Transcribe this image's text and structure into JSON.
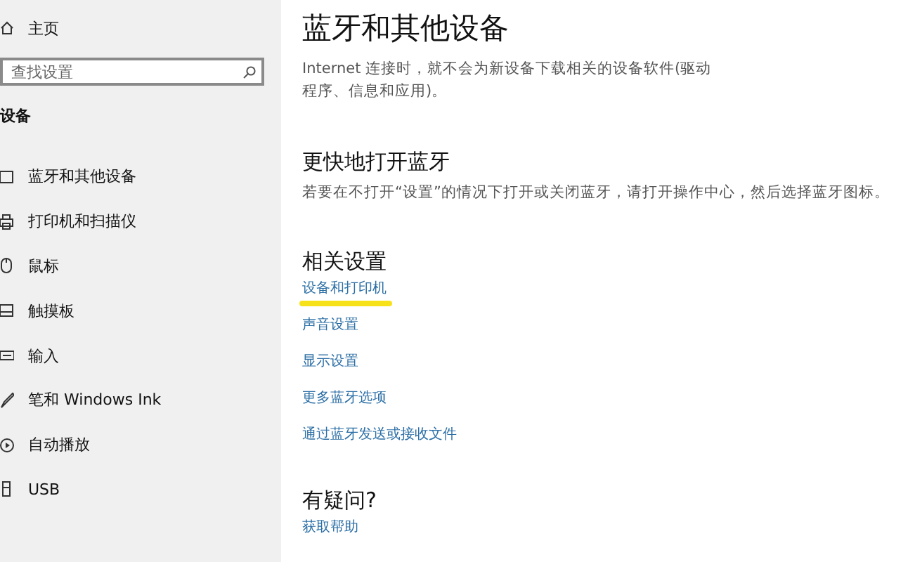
{
  "sidebar": {
    "home": "主页",
    "search": {
      "placeholder": "查找设置"
    },
    "section": "设备",
    "items": [
      {
        "label": "蓝牙和其他设备",
        "kind": "bluetooth",
        "selected": false
      },
      {
        "label": "打印机和扫描仪",
        "kind": "printer",
        "selected": false
      },
      {
        "label": "鼠标",
        "kind": "mouse",
        "selected": false
      },
      {
        "label": "触摸板",
        "kind": "touchpad",
        "selected": false
      },
      {
        "label": "输入",
        "kind": "keyboard",
        "selected": false
      },
      {
        "label": "笔和 Windows Ink",
        "kind": "pen",
        "selected": false
      },
      {
        "label": "自动播放",
        "kind": "autoplay",
        "selected": false
      },
      {
        "label": "USB",
        "kind": "usb",
        "selected": false
      }
    ]
  },
  "content": {
    "title": "蓝牙和其他设备",
    "intro": "Internet 连接时，就不会为新设备下载相关的设备软件(驱动程序、信息和应用)。",
    "sections": [
      {
        "heading": "更快地打开蓝牙",
        "text": "若要在不打开“设置”的情况下打开或关闭蓝牙，请打开操作中心，然后选择蓝牙图标。"
      },
      {
        "heading": "相关设置",
        "links": [
          {
            "label": "设备和打印机",
            "highlighted": true
          },
          {
            "label": "声音设置",
            "highlighted": false
          },
          {
            "label": "显示设置",
            "highlighted": false
          },
          {
            "label": "更多蓝牙选项",
            "highlighted": false
          },
          {
            "label": "通过蓝牙发送或接收文件",
            "highlighted": false
          }
        ]
      },
      {
        "heading": "有疑问?",
        "links": [
          {
            "label": "获取帮助",
            "highlighted": false
          }
        ]
      }
    ]
  }
}
